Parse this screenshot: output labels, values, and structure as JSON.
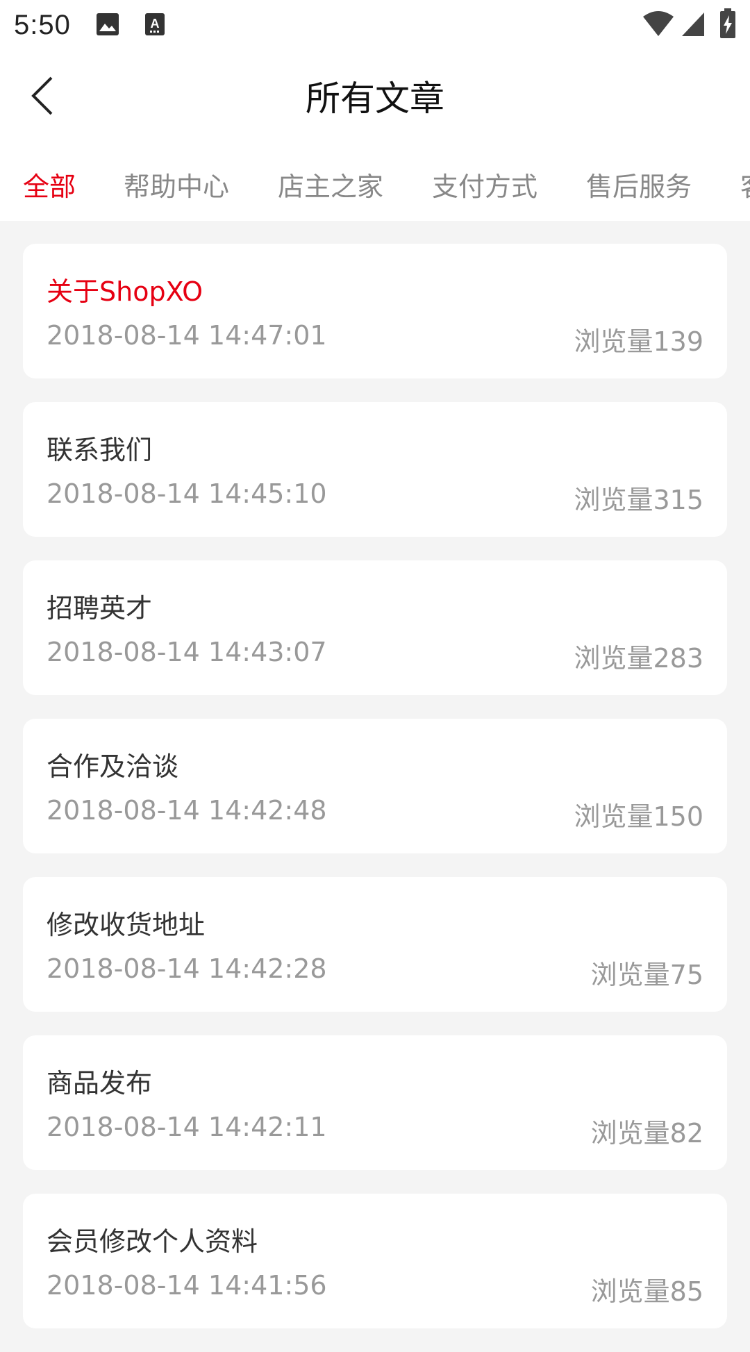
{
  "status_bar": {
    "time": "5:50",
    "icons": [
      "image-icon",
      "keyboard-icon",
      "wifi-icon",
      "signal-icon",
      "battery-charging-icon"
    ]
  },
  "header": {
    "title": "所有文章",
    "back_icon": "chevron-left-icon"
  },
  "tabs": [
    {
      "label": "全部",
      "active": true
    },
    {
      "label": "帮助中心",
      "active": false
    },
    {
      "label": "店主之家",
      "active": false
    },
    {
      "label": "支付方式",
      "active": false
    },
    {
      "label": "售后服务",
      "active": false
    },
    {
      "label": "客",
      "active": false
    }
  ],
  "articles": [
    {
      "title": "关于ShopXO",
      "date": "2018-08-14 14:47:01",
      "views": "浏览量139",
      "highlight": true
    },
    {
      "title": "联系我们",
      "date": "2018-08-14 14:45:10",
      "views": "浏览量315",
      "highlight": false
    },
    {
      "title": "招聘英才",
      "date": "2018-08-14 14:43:07",
      "views": "浏览量283",
      "highlight": false
    },
    {
      "title": "合作及洽谈",
      "date": "2018-08-14 14:42:48",
      "views": "浏览量150",
      "highlight": false
    },
    {
      "title": "修改收货地址",
      "date": "2018-08-14 14:42:28",
      "views": "浏览量75",
      "highlight": false
    },
    {
      "title": "商品发布",
      "date": "2018-08-14 14:42:11",
      "views": "浏览量82",
      "highlight": false
    },
    {
      "title": "会员修改个人资料",
      "date": "2018-08-14 14:41:56",
      "views": "浏览量85",
      "highlight": false
    }
  ],
  "colors": {
    "accent": "#e60012",
    "background": "#f4f4f4",
    "card": "#ffffff",
    "muted_text": "#999999"
  }
}
